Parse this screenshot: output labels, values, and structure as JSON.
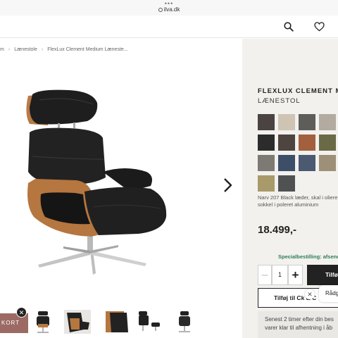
{
  "browser": {
    "dots": "•••",
    "url": "ilva.dk"
  },
  "header": {
    "icons": [
      "search-icon",
      "heart-icon"
    ]
  },
  "breadcrumb": {
    "items": [
      "m",
      "Lænestole",
      "FlexLux Clement Medium Læneste..."
    ],
    "separator": "›"
  },
  "gallery": {
    "main_image": "flexlux-clement-chair",
    "next_icon": "chevron-right-icon",
    "thumbnails": [
      "chair-front",
      "chair-side",
      "chair-detail",
      "chair-with-stool",
      "chair-back"
    ]
  },
  "promo": {
    "label": "KORT",
    "close": "✕"
  },
  "product": {
    "title": "FLEXLUX CLEMENT MEDI",
    "subtitle": "LÆNESTOL",
    "swatches": [
      "#4a4340",
      "#cfc4b3",
      "#5e5d59",
      "#b3ab9f",
      "#2c2c2c",
      "#4e4540",
      "#a3603e",
      "#6b6a46",
      "#7c7a72",
      "#3c4e68",
      "#4b5971",
      "#9e9078",
      "#a99a6c",
      "#505153"
    ],
    "description_line1": "Narv 207 Black læder, skal i oliere",
    "description_line2": "sokkel i poleret aluminium",
    "price": "18.499,-",
    "special_order": "Specialbestilling: afsend",
    "quantity": "1",
    "qty_minus": "–",
    "qty_plus": "+",
    "add_button": "Tilfø",
    "add_secondary": "Tilføj til C",
    "add_secondary_tail": "k & C",
    "notice_line1": "Senest 2 timer efter din bes",
    "notice_line2": "varer klar til afhentning i åb"
  },
  "chat": {
    "close": "✕",
    "label": "Rådg"
  }
}
